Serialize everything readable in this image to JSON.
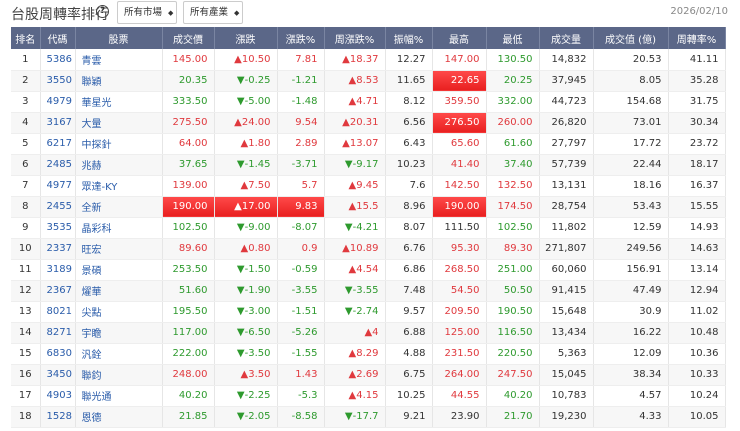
{
  "header": {
    "title": "台股周轉率排行",
    "help_icon": "?",
    "market_select": "所有市場",
    "industry_select": "所有產業",
    "date": "2026/02/10"
  },
  "columns": [
    "排名",
    "代碼",
    "股票",
    "成交價",
    "漲跌",
    "漲跌%",
    "周漲跌%",
    "振幅%",
    "最高",
    "最低",
    "成交量",
    "成交值 (億)",
    "周轉率%"
  ],
  "colors": {
    "up": "#e0393e",
    "down": "#2e9a2e",
    "header": "#5b6788",
    "limit": "#f03030"
  },
  "rows": [
    {
      "rank": "1",
      "code": "5386",
      "name": "青雲",
      "price": "145.00",
      "chg": "▲10.50",
      "pct": "7.81",
      "wk": "▲18.37",
      "amp": "12.27",
      "high": "147.00",
      "low": "130.50",
      "vol": "14,832",
      "val": "20.53",
      "turn": "41.11",
      "c": [
        "up",
        "up",
        "up",
        "up",
        "down"
      ]
    },
    {
      "rank": "2",
      "code": "3550",
      "name": "聯穎",
      "price": "20.35",
      "chg": "▼-0.25",
      "pct": "-1.21",
      "wk": "▲8.53",
      "amp": "11.65",
      "high": "22.65",
      "low": "20.25",
      "vol": "37,945",
      "val": "8.05",
      "turn": "35.28",
      "c": [
        "down",
        "down",
        "up",
        "limit",
        "down"
      ]
    },
    {
      "rank": "3",
      "code": "4979",
      "name": "華星光",
      "price": "333.50",
      "chg": "▼-5.00",
      "pct": "-1.48",
      "wk": "▲4.71",
      "amp": "8.12",
      "high": "359.50",
      "low": "332.00",
      "vol": "44,723",
      "val": "154.68",
      "turn": "31.75",
      "c": [
        "down",
        "down",
        "up",
        "up",
        "down"
      ]
    },
    {
      "rank": "4",
      "code": "3167",
      "name": "大量",
      "price": "275.50",
      "chg": "▲24.00",
      "pct": "9.54",
      "wk": "▲20.31",
      "amp": "6.56",
      "high": "276.50",
      "low": "260.00",
      "vol": "26,820",
      "val": "73.01",
      "turn": "30.34",
      "c": [
        "up",
        "up",
        "up",
        "limit",
        "up"
      ]
    },
    {
      "rank": "5",
      "code": "6217",
      "name": "中探針",
      "price": "64.00",
      "chg": "▲1.80",
      "pct": "2.89",
      "wk": "▲13.07",
      "amp": "6.43",
      "high": "65.60",
      "low": "61.60",
      "vol": "27,797",
      "val": "17.72",
      "turn": "23.72",
      "c": [
        "up",
        "up",
        "up",
        "up",
        "down"
      ]
    },
    {
      "rank": "6",
      "code": "2485",
      "name": "兆赫",
      "price": "37.65",
      "chg": "▼-1.45",
      "pct": "-3.71",
      "wk": "▼-9.17",
      "amp": "10.23",
      "high": "41.40",
      "low": "37.40",
      "vol": "57,739",
      "val": "22.44",
      "turn": "18.17",
      "c": [
        "down",
        "down",
        "down",
        "up",
        "down"
      ]
    },
    {
      "rank": "7",
      "code": "4977",
      "name": "眾達-KY",
      "price": "139.00",
      "chg": "▲7.50",
      "pct": "5.7",
      "wk": "▲9.45",
      "amp": "7.6",
      "high": "142.50",
      "low": "132.50",
      "vol": "13,131",
      "val": "18.16",
      "turn": "16.37",
      "c": [
        "up",
        "up",
        "up",
        "up",
        "up"
      ]
    },
    {
      "rank": "8",
      "code": "2455",
      "name": "全新",
      "price": "190.00",
      "chg": "▲17.00",
      "pct": "9.83",
      "wk": "▲15.5",
      "amp": "8.96",
      "high": "190.00",
      "low": "174.50",
      "vol": "28,754",
      "val": "53.43",
      "turn": "15.55",
      "c": [
        "limit",
        "limit",
        "up",
        "limit",
        "up"
      ]
    },
    {
      "rank": "9",
      "code": "3535",
      "name": "晶彩科",
      "price": "102.50",
      "chg": "▼-9.00",
      "pct": "-8.07",
      "wk": "▼-4.21",
      "amp": "8.07",
      "high": "111.50",
      "low": "102.50",
      "vol": "11,802",
      "val": "12.59",
      "turn": "14.93",
      "c": [
        "down",
        "down",
        "down",
        "flat",
        "down"
      ]
    },
    {
      "rank": "10",
      "code": "2337",
      "name": "旺宏",
      "price": "89.60",
      "chg": "▲0.80",
      "pct": "0.9",
      "wk": "▲10.89",
      "amp": "6.76",
      "high": "95.30",
      "low": "89.30",
      "vol": "271,807",
      "val": "249.56",
      "turn": "14.63",
      "c": [
        "up",
        "up",
        "up",
        "up",
        "up"
      ]
    },
    {
      "rank": "11",
      "code": "3189",
      "name": "景碩",
      "price": "253.50",
      "chg": "▼-1.50",
      "pct": "-0.59",
      "wk": "▲4.54",
      "amp": "6.86",
      "high": "268.50",
      "low": "251.00",
      "vol": "60,060",
      "val": "156.91",
      "turn": "13.14",
      "c": [
        "down",
        "down",
        "up",
        "up",
        "down"
      ]
    },
    {
      "rank": "12",
      "code": "2367",
      "name": "燿華",
      "price": "51.60",
      "chg": "▼-1.90",
      "pct": "-3.55",
      "wk": "▼-3.55",
      "amp": "7.48",
      "high": "54.50",
      "low": "50.50",
      "vol": "91,415",
      "val": "47.49",
      "turn": "12.94",
      "c": [
        "down",
        "down",
        "down",
        "up",
        "down"
      ]
    },
    {
      "rank": "13",
      "code": "8021",
      "name": "尖點",
      "price": "195.50",
      "chg": "▼-3.00",
      "pct": "-1.51",
      "wk": "▼-2.74",
      "amp": "9.57",
      "high": "209.50",
      "low": "190.50",
      "vol": "15,648",
      "val": "30.9",
      "turn": "11.02",
      "c": [
        "down",
        "down",
        "down",
        "up",
        "down"
      ]
    },
    {
      "rank": "14",
      "code": "8271",
      "name": "宇瞻",
      "price": "117.00",
      "chg": "▼-6.50",
      "pct": "-5.26",
      "wk": "▲4",
      "amp": "6.88",
      "high": "125.00",
      "low": "116.50",
      "vol": "13,434",
      "val": "16.22",
      "turn": "10.48",
      "c": [
        "down",
        "down",
        "up",
        "up",
        "down"
      ]
    },
    {
      "rank": "15",
      "code": "6830",
      "name": "汎銓",
      "price": "222.00",
      "chg": "▼-3.50",
      "pct": "-1.55",
      "wk": "▲8.29",
      "amp": "4.88",
      "high": "231.50",
      "low": "220.50",
      "vol": "5,363",
      "val": "12.09",
      "turn": "10.36",
      "c": [
        "down",
        "down",
        "up",
        "up",
        "down"
      ]
    },
    {
      "rank": "16",
      "code": "3450",
      "name": "聯鈞",
      "price": "248.00",
      "chg": "▲3.50",
      "pct": "1.43",
      "wk": "▲2.69",
      "amp": "6.75",
      "high": "264.00",
      "low": "247.50",
      "vol": "15,045",
      "val": "38.34",
      "turn": "10.33",
      "c": [
        "up",
        "up",
        "up",
        "up",
        "up"
      ]
    },
    {
      "rank": "17",
      "code": "4903",
      "name": "聯光通",
      "price": "40.20",
      "chg": "▼-2.25",
      "pct": "-5.3",
      "wk": "▲4.15",
      "amp": "10.25",
      "high": "44.55",
      "low": "40.20",
      "vol": "10,783",
      "val": "4.57",
      "turn": "10.24",
      "c": [
        "down",
        "down",
        "up",
        "up",
        "down"
      ]
    },
    {
      "rank": "18",
      "code": "1528",
      "name": "恩德",
      "price": "21.85",
      "chg": "▼-2.05",
      "pct": "-8.58",
      "wk": "▼-17.7",
      "amp": "9.21",
      "high": "23.90",
      "low": "21.70",
      "vol": "19,230",
      "val": "4.33",
      "turn": "10.05",
      "c": [
        "down",
        "down",
        "down",
        "flat",
        "down"
      ]
    }
  ]
}
